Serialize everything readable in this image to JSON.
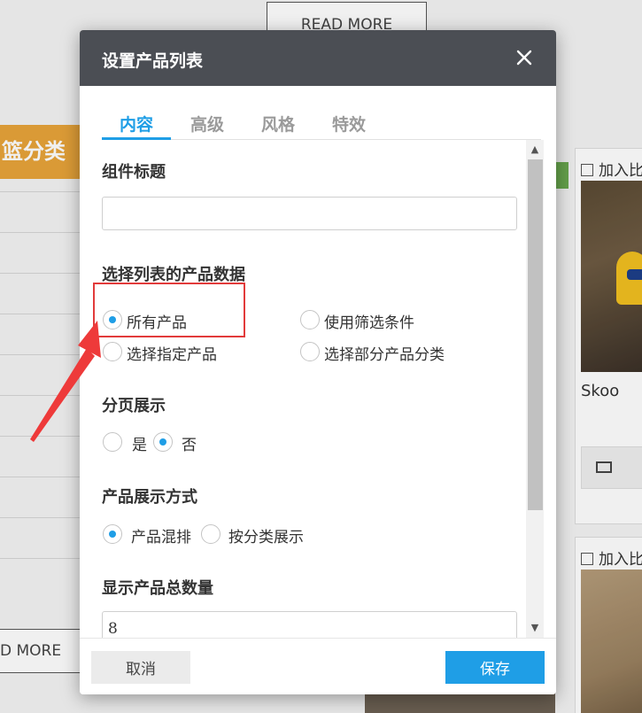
{
  "background": {
    "read_more_top": "READ MORE",
    "category_label": "篮分类",
    "read_more_bottom": "D MORE",
    "compare_label_1": "加入比",
    "compare_label_2": "加入比",
    "product_name": "Skoo"
  },
  "dialog": {
    "title": "设置产品列表",
    "tabs": [
      "内容",
      "高级",
      "风格",
      "特效"
    ],
    "active_tab": "内容",
    "component_title": {
      "label": "组件标题",
      "value": ""
    },
    "data_source": {
      "label": "选择列表的产品数据",
      "options": [
        "所有产品",
        "使用筛选条件",
        "选择指定产品",
        "选择部分产品分类"
      ],
      "selected": "所有产品"
    },
    "pagination": {
      "label": "分页展示",
      "options": [
        "是",
        "否"
      ],
      "selected": "否"
    },
    "display_mode": {
      "label": "产品展示方式",
      "options": [
        "产品混排",
        "按分类展示"
      ],
      "selected": "产品混排"
    },
    "total_count": {
      "label": "显示产品总数量",
      "value": "8"
    },
    "buttons": {
      "cancel": "取消",
      "save": "保存"
    }
  },
  "colors": {
    "header_bg": "#4b4e54",
    "accent": "#1f9ee6",
    "highlight": "#e23b3b",
    "category_bg": "#e8a43a"
  }
}
